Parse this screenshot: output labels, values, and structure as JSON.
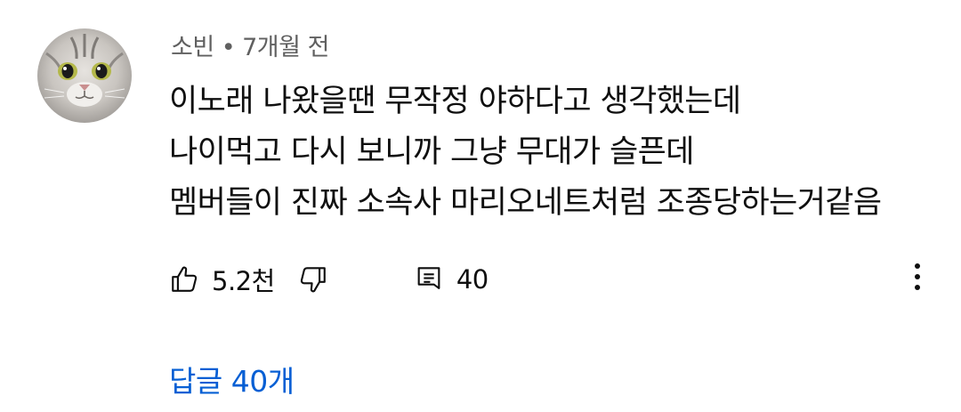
{
  "comment": {
    "author": "소빈",
    "separator": "•",
    "time": "7개월 전",
    "lines": [
      "이노래 나왔을땐 무작정 야하다고 생각했는데",
      "나이먹고 다시 보니까 그냥 무대가 슬픈데",
      "멤버들이 진짜 소속사 마리오네트처럼 조종당하는거같음"
    ],
    "likes": "5.2천",
    "reply_count": "40",
    "replies_label": "답글 40개"
  },
  "icons": {
    "like": "thumbs-up-icon",
    "dislike": "thumbs-down-icon",
    "reply": "comment-icon",
    "more": "more-vertical-icon",
    "avatar": "cat-avatar"
  },
  "colors": {
    "text": "#0f0f0f",
    "meta": "#606060",
    "link": "#065fd4"
  }
}
